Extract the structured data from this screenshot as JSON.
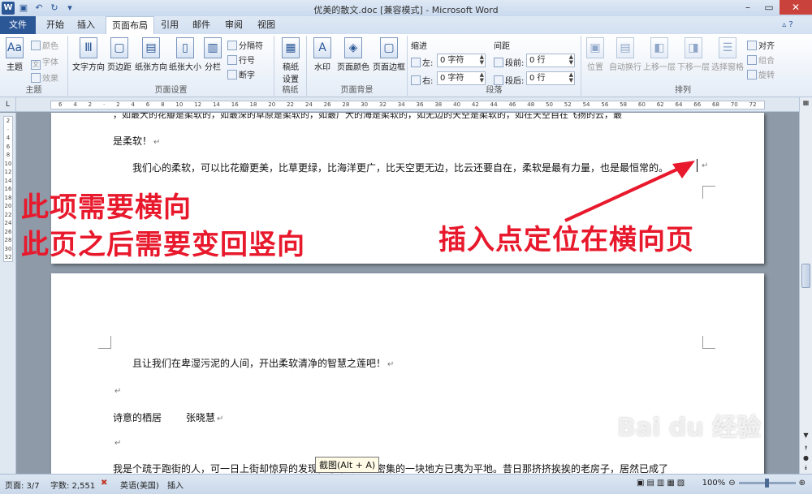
{
  "titlebar": {
    "title": "优美的散文.doc [兼容模式] - Microsoft Word",
    "app_icon": "W"
  },
  "tabs": {
    "file": "文件",
    "home": "开始",
    "insert": "插入",
    "layout": "页面布局",
    "references": "引用",
    "mailings": "邮件",
    "review": "审阅",
    "view": "视图"
  },
  "ribbon": {
    "theme": {
      "label": "主题",
      "big": "主题",
      "colors": "颜色",
      "fonts": "字体",
      "effects": "效果"
    },
    "page_setup": {
      "label": "页面设置",
      "text_direction": "文字方向",
      "margins": "页边距",
      "orientation": "纸张方向",
      "size": "纸张大小",
      "columns": "分栏",
      "breaks": "分隔符",
      "line_numbers": "行号",
      "hyphenation": "断字"
    },
    "draft": {
      "label": "稿纸",
      "big": "稿纸\n设置"
    },
    "background": {
      "label": "页面背景",
      "watermark": "水印",
      "page_color": "页面颜色",
      "page_borders": "页面边框"
    },
    "paragraph": {
      "label": "段落",
      "indent": "缩进",
      "spacing": "间距",
      "left": "左:",
      "right": "右:",
      "before": "段前:",
      "after": "段后:",
      "left_val": "0 字符",
      "right_val": "0 字符",
      "before_val": "0 行",
      "after_val": "0 行"
    },
    "arrange": {
      "label": "排列",
      "position": "位置",
      "wrap": "自动换行",
      "forward": "上移一层",
      "backward": "下移一层",
      "pane": "选择窗格",
      "align": "对齐",
      "group": "组合",
      "rotate": "旋转"
    }
  },
  "ruler": {
    "corner": "L",
    "nums": [
      "6",
      "4",
      "2",
      "",
      "2",
      "4",
      "6",
      "8",
      "10",
      "12",
      "14",
      "16",
      "18",
      "20",
      "22",
      "24",
      "26",
      "28",
      "30",
      "32",
      "34",
      "36",
      "38",
      "40",
      "42",
      "44",
      "46",
      "48",
      "50",
      "52",
      "54",
      "56",
      "58",
      "60",
      "62",
      "64",
      "66",
      "68",
      "70",
      "72"
    ],
    "vnums": [
      "2",
      "",
      "4",
      "6",
      "8",
      "10",
      "12",
      "14",
      "16",
      "18",
      "20",
      "22",
      "24",
      "26",
      "28",
      "30",
      "32"
    ]
  },
  "document": {
    "p1_line0": "，如最大的花瓣是柔软的，如最深的草原是柔软的，如最广大的海是柔软的，如无边的天空是柔软的，如在天空自在飞扬的云，最",
    "p1_line1": "是柔软！",
    "p1_line2": "我们心的柔软，可以比花瓣更美，比草更绿，比海洋更广，比天空更无边，比云还要自在，柔软是最有力量，也是最恒常的。",
    "p2_line1": "且让我们在卑湿污泥的人间，开出柔软清净的智慧之莲吧！",
    "p2_title": "诗意的栖居",
    "p2_author": "张晓慧",
    "p2_line2": "我是个疏于跑街的人，可一日上街却惊异的发现，原来那里巷密集的一块地方已夷为平地。昔日那挤挤挨挨的老房子，居然已成了"
  },
  "annotations": {
    "note1": "此项需要横向",
    "note2": "此页之后需要变回竖向",
    "note3": "插入点定位在横向页",
    "color": "#e8192c"
  },
  "tooltip": "截图(Alt + A)",
  "watermark": "Bai du 经验",
  "status": {
    "page": "页面: 3/7",
    "words": "字数: 2,551",
    "lang": "英语(美国)",
    "mode": "插入",
    "zoom": "100%"
  }
}
